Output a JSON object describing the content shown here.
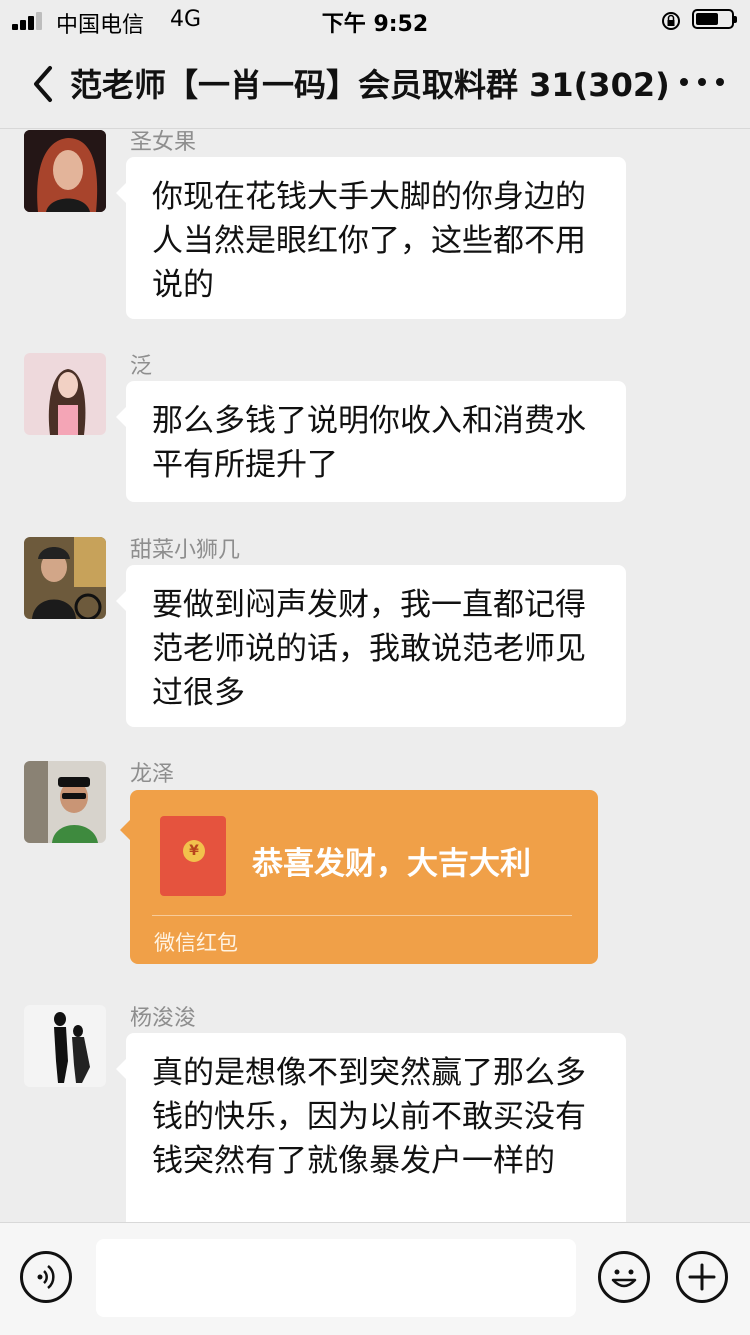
{
  "status_bar": {
    "carrier": "中国电信",
    "network": "4G",
    "time": "下午 9:52"
  },
  "nav": {
    "title": "范老师【一肖一码】会员取料群 31(302)",
    "back_icon": "chevron-left-icon",
    "more_icon": "ellipsis-icon"
  },
  "messages": [
    {
      "sender": "圣女果",
      "text": "你现在花钱大手大脚的你身边的人当然是眼红你了，这些都不用说的"
    },
    {
      "sender": "泛",
      "text": "那么多钱了说明你收入和消费水平有所提升了"
    },
    {
      "sender": "甜菜小狮几",
      "text": "要做到闷声发财，我一直都记得范老师说的话，我敢说范老师见过很多"
    },
    {
      "sender": "龙泽",
      "red_packet": {
        "title": "恭喜发财，大吉大利",
        "label": "微信红包",
        "coin": "¥"
      }
    },
    {
      "sender": "杨浚浚",
      "text": "真的是想像不到突然赢了那么多钱的快乐，因为以前不敢买没有钱突然有了就像暴发户一样的"
    }
  ],
  "input_bar": {
    "voice_icon": "voice-icon",
    "emoji_icon": "emoji-icon",
    "plus_icon": "plus-icon"
  },
  "colors": {
    "background": "#ededed",
    "bubble": "#ffffff",
    "red_packet": "#f0a048",
    "envelope": "#e5533e"
  }
}
